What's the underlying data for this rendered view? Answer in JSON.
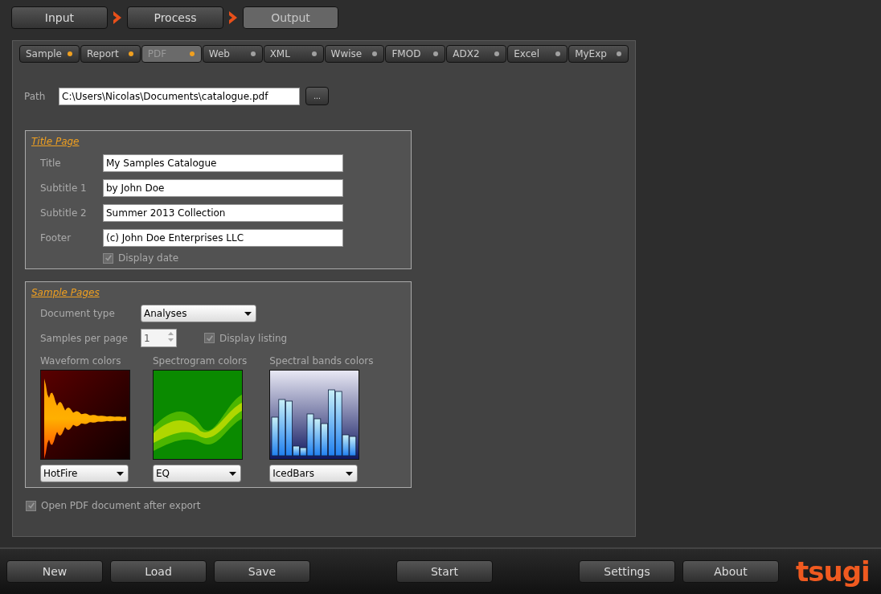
{
  "steps": [
    {
      "label": "Input",
      "selected": false
    },
    {
      "label": "Process",
      "selected": false
    },
    {
      "label": "Output",
      "selected": true
    }
  ],
  "tabs": [
    {
      "label": "Sample",
      "selected": false,
      "color": "#f0a020"
    },
    {
      "label": "Report",
      "selected": false,
      "color": "#f0a020"
    },
    {
      "label": "PDF",
      "selected": true,
      "color": "#f0a020"
    },
    {
      "label": "Web",
      "selected": false,
      "color": "#a0a0a0"
    },
    {
      "label": "XML",
      "selected": false,
      "color": "#a0a0a0"
    },
    {
      "label": "Wwise",
      "selected": false,
      "color": "#a0a0a0"
    },
    {
      "label": "FMOD",
      "selected": false,
      "color": "#a0a0a0"
    },
    {
      "label": "ADX2",
      "selected": false,
      "color": "#a0a0a0"
    },
    {
      "label": "Excel",
      "selected": false,
      "color": "#a0a0a0"
    },
    {
      "label": "MyExp",
      "selected": false,
      "color": "#a0a0a0"
    }
  ],
  "path": {
    "label": "Path",
    "value": "C:\\Users\\Nicolas\\Documents\\catalogue.pdf",
    "browse": "..."
  },
  "title_page": {
    "heading": "Title Page",
    "fields": [
      {
        "label": "Title",
        "value": "My Samples Catalogue"
      },
      {
        "label": "Subtitle 1",
        "value": "by John Doe"
      },
      {
        "label": "Subtitle 2",
        "value": "Summer 2013 Collection"
      },
      {
        "label": "Footer",
        "value": "(c) John Doe Enterprises LLC"
      }
    ],
    "display_date": {
      "label": "Display date",
      "checked": true
    }
  },
  "sample_pages": {
    "heading": "Sample Pages",
    "document_type": {
      "label": "Document type",
      "value": "Analyses"
    },
    "samples_per_page": {
      "label": "Samples per page",
      "value": "1"
    },
    "display_listing": {
      "label": "Display listing",
      "checked": true
    },
    "palettes": [
      {
        "kind": "waveform",
        "label": "Waveform colors",
        "value": "HotFire"
      },
      {
        "kind": "spectrogram",
        "label": "Spectrogram colors",
        "value": "EQ"
      },
      {
        "kind": "bands",
        "label": "Spectral bands colors",
        "value": "IcedBars"
      }
    ]
  },
  "open_after_export": {
    "label": "Open PDF document after export",
    "checked": true
  },
  "bottom_buttons": [
    "New",
    "Load",
    "Save",
    "Start",
    "Settings",
    "About"
  ],
  "logo": "tsugi"
}
